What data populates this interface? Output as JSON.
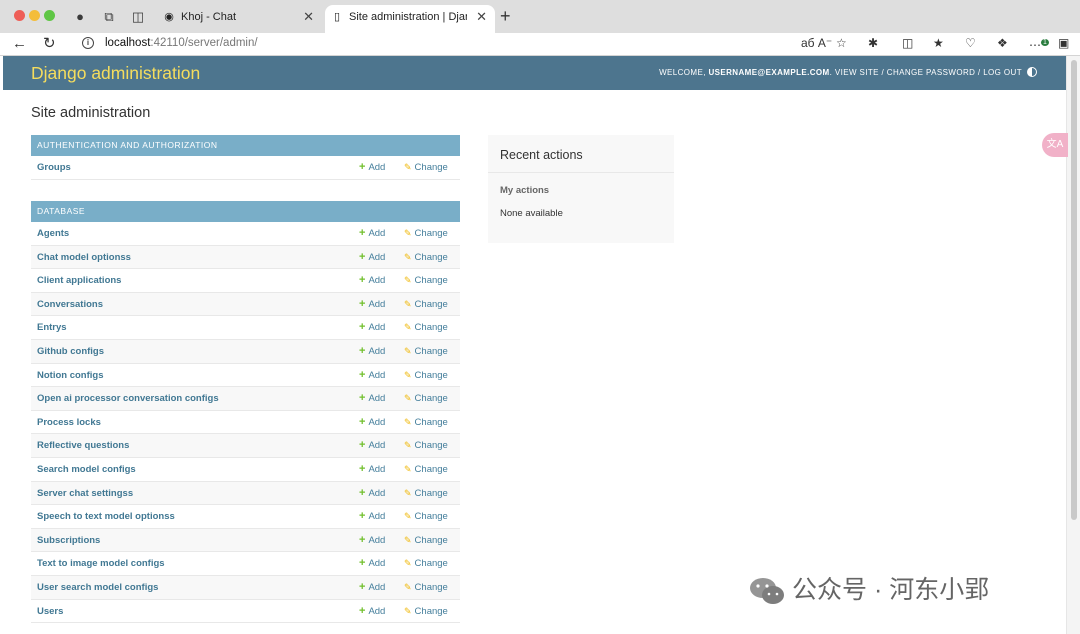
{
  "browser": {
    "tabs": [
      {
        "title": "Khoj - Chat",
        "active": false
      },
      {
        "title": "Site administration | Django site admin",
        "active": true
      }
    ],
    "url_host": "localhost",
    "url_path": ":42110/server/admin/",
    "new_tab": "+",
    "badge_count": "1"
  },
  "header": {
    "brand": "Django administration",
    "welcome": "WELCOME,",
    "username": "USERNAME@EXAMPLE.COM",
    "view_site": "VIEW SITE",
    "change_password": "CHANGE PASSWORD",
    "log_out": "LOG OUT",
    "separator": " / "
  },
  "page_title": "Site administration",
  "modules": [
    {
      "caption": "AUTHENTICATION AND AUTHORIZATION",
      "models": [
        "Groups"
      ]
    },
    {
      "caption": "DATABASE",
      "models": [
        "Agents",
        "Chat model optionss",
        "Client applications",
        "Conversations",
        "Entrys",
        "Github configs",
        "Notion configs",
        "Open ai processor conversation configs",
        "Process locks",
        "Reflective questions",
        "Search model configs",
        "Server chat settingss",
        "Speech to text model optionss",
        "Subscriptions",
        "Text to image model configs",
        "User search model configs",
        "Users"
      ]
    }
  ],
  "actions": {
    "add": "Add",
    "change": "Change"
  },
  "recent": {
    "title": "Recent actions",
    "subtitle": "My actions",
    "empty": "None available"
  },
  "watermark": "公众号 · 河东小郢",
  "colors": {
    "header_bg": "#4d758e",
    "brand": "#f5dd5d",
    "caption_bg": "#79aec8",
    "link": "#417893",
    "add_icon": "#70bf2b",
    "change_icon": "#efb80b"
  }
}
